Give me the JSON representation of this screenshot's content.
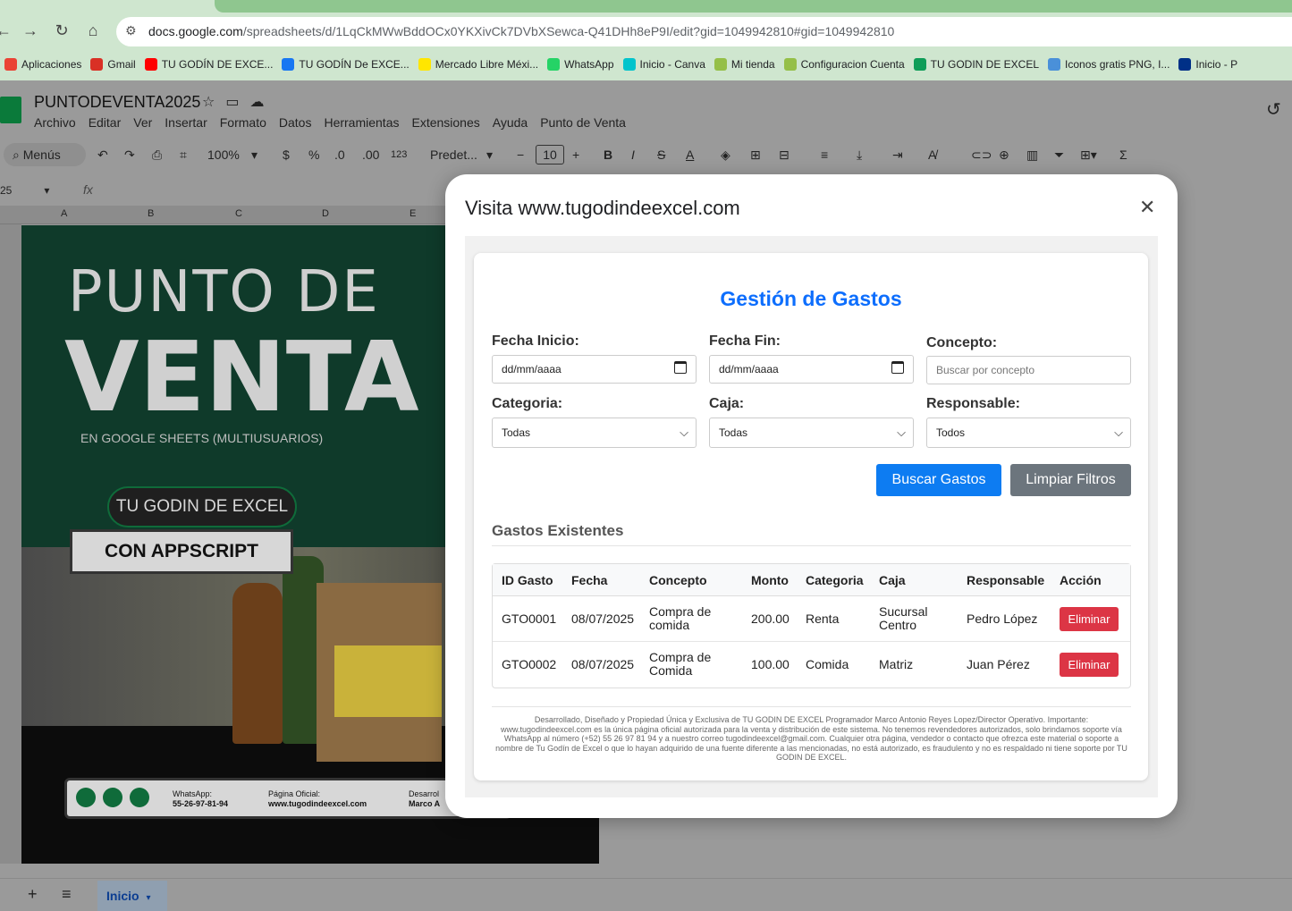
{
  "browser": {
    "url_domain": "docs.google.com",
    "url_path": "/spreadsheets/d/1LqCkMWwBddOCx0YKXivCk7DVbXSewca-Q41DHh8eP9I/edit?gid=1049942810#gid=1049942810",
    "bookmarks": [
      {
        "label": "Aplicaciones",
        "color": "#ea4335"
      },
      {
        "label": "Gmail",
        "color": "#d93025"
      },
      {
        "label": "TU GODÍN DE EXCE...",
        "color": "#ff0000"
      },
      {
        "label": "TU GODÍN De EXCE...",
        "color": "#1877f2"
      },
      {
        "label": "Mercado Libre Méxi...",
        "color": "#ffe600"
      },
      {
        "label": "WhatsApp",
        "color": "#25d366"
      },
      {
        "label": "Inicio - Canva",
        "color": "#00c4cc"
      },
      {
        "label": "Mi tienda",
        "color": "#95bf47"
      },
      {
        "label": "Configuracion Cuenta",
        "color": "#95bf47"
      },
      {
        "label": "TU GODIN DE EXCEL",
        "color": "#0f9d58"
      },
      {
        "label": "Iconos gratis PNG, I...",
        "color": "#4a90d9"
      },
      {
        "label": "Inicio - P",
        "color": "#003087"
      }
    ]
  },
  "sheets": {
    "doc_title": "PUNTODEVENTA2025",
    "menu": [
      "Archivo",
      "Editar",
      "Ver",
      "Insertar",
      "Formato",
      "Datos",
      "Herramientas",
      "Extensiones",
      "Ayuda",
      "Punto de Venta"
    ],
    "toolbar": {
      "menus_label": "Menús",
      "zoom": "100%",
      "currency": "$",
      "percent": "%",
      "dec_down": ".0",
      "dec_up": ".00",
      "number_format": "123",
      "font": "Predet...",
      "font_size": "10"
    },
    "name_box": "25",
    "columns": [
      "A",
      "B",
      "C",
      "D",
      "E"
    ],
    "sheet_tab": "Inicio"
  },
  "poster": {
    "title_line1": "PUNTO DE",
    "title_line2": "VENTA",
    "subtitle": "EN GOOGLE SHEETS (MULTIUSUARIOS)",
    "pill": "TU GODIN DE EXCEL",
    "badge": "CON APPSCRIPT",
    "whatsapp_label": "WhatsApp:",
    "whatsapp_number": "55-26-97-81-94",
    "site_label": "Página Oficial:",
    "site_url": "www.tugodindeexcel.com",
    "dev_label": "Desarrol",
    "dev_name": "Marco A"
  },
  "modal": {
    "title": "Visita www.tugodindeexcel.com",
    "heading": "Gestión de Gastos",
    "filters": {
      "fecha_inicio_label": "Fecha Inicio:",
      "fecha_inicio_value": "dd/mm/aaaa",
      "fecha_fin_label": "Fecha Fin:",
      "fecha_fin_value": "dd/mm/aaaa",
      "concepto_label": "Concepto:",
      "concepto_placeholder": "Buscar por concepto",
      "categoria_label": "Categoria:",
      "categoria_value": "Todas",
      "caja_label": "Caja:",
      "caja_value": "Todas",
      "responsable_label": "Responsable:",
      "responsable_value": "Todos"
    },
    "buttons": {
      "search": "Buscar Gastos",
      "clear": "Limpiar Filtros"
    },
    "section_title": "Gastos Existentes",
    "table": {
      "headers": [
        "ID Gasto",
        "Fecha",
        "Concepto",
        "Monto",
        "Categoria",
        "Caja",
        "Responsable",
        "Acción"
      ],
      "rows": [
        {
          "id": "GTO0001",
          "fecha": "08/07/2025",
          "concepto_1": "Compra de",
          "concepto_2": "comida",
          "monto": "200.00",
          "categoria": "Renta",
          "caja_1": "Sucursal",
          "caja_2": "Centro",
          "responsable": "Pedro López",
          "accion": "Eliminar"
        },
        {
          "id": "GTO0002",
          "fecha": "08/07/2025",
          "concepto_1": "Compra de",
          "concepto_2": "Comida",
          "monto": "100.00",
          "categoria": "Comida",
          "caja_1": "Matriz",
          "caja_2": "",
          "responsable": "Juan Pérez",
          "accion": "Eliminar"
        }
      ]
    },
    "footer": "Desarrollado, Diseñado y Propiedad Única y Exclusiva de TU GODIN DE EXCEL Programador Marco Antonio Reyes Lopez/Director Operativo. Importante: www.tugodindeexcel.com es la única página oficial autorizada para la venta y distribución de este sistema. No tenemos revendedores autorizados, solo brindamos soporte vía WhatsApp al número (+52) 55 26 97 81 94 y a nuestro correo tugodindeexcel@gmail.com. Cualquier otra página, vendedor o contacto que ofrezca este material o soporte a nombre de Tu Godín de Excel o que lo hayan adquirido de una fuente diferente a las mencionadas, no está autorizado, es fraudulento y no es respaldado ni tiene soporte por TU GODIN DE EXCEL."
  }
}
